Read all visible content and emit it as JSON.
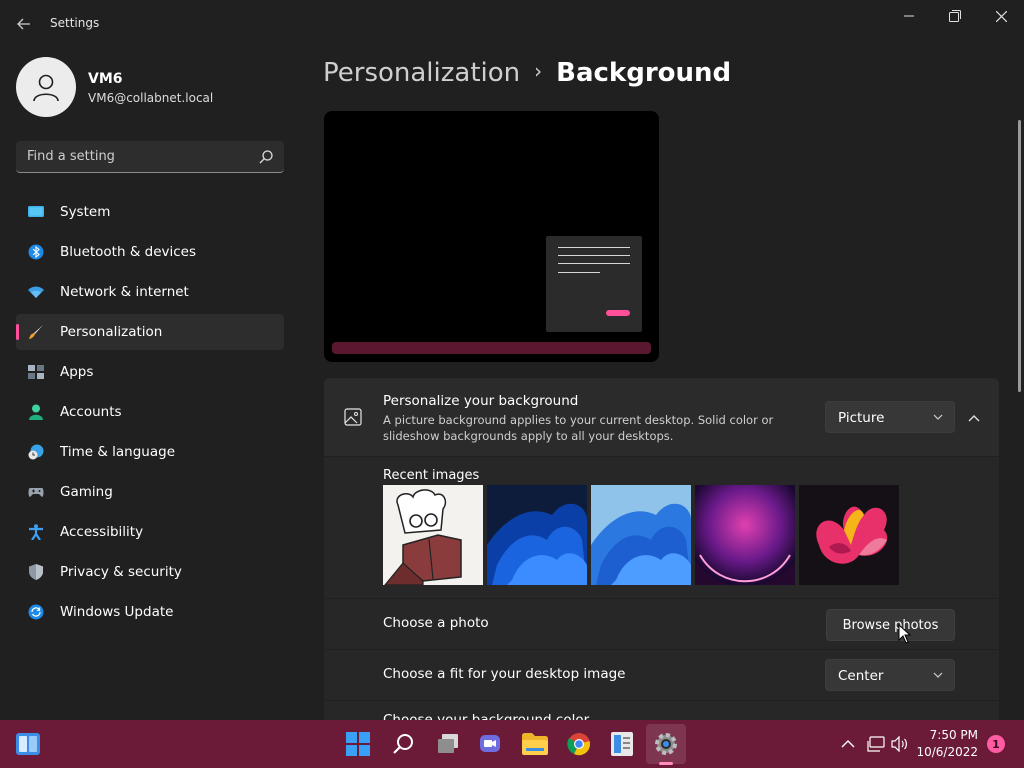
{
  "window": {
    "title": "Settings"
  },
  "user": {
    "name": "VM6",
    "email": "VM6@collabnet.local"
  },
  "search": {
    "placeholder": "Find a setting"
  },
  "sidebar": {
    "items": [
      {
        "label": "System",
        "icon": "monitor-icon"
      },
      {
        "label": "Bluetooth & devices",
        "icon": "bluetooth-icon"
      },
      {
        "label": "Network & internet",
        "icon": "wifi-icon"
      },
      {
        "label": "Personalization",
        "icon": "brush-icon",
        "selected": true
      },
      {
        "label": "Apps",
        "icon": "apps-icon"
      },
      {
        "label": "Accounts",
        "icon": "person-icon"
      },
      {
        "label": "Time & language",
        "icon": "clock-globe-icon"
      },
      {
        "label": "Gaming",
        "icon": "gamepad-icon"
      },
      {
        "label": "Accessibility",
        "icon": "accessibility-icon"
      },
      {
        "label": "Privacy & security",
        "icon": "shield-icon"
      },
      {
        "label": "Windows Update",
        "icon": "update-icon"
      }
    ]
  },
  "breadcrumb": {
    "parent": "Personalization",
    "separator": "›",
    "current": "Background"
  },
  "background_setting": {
    "title": "Personalize your background",
    "description": "A picture background applies to your current desktop. Solid color or slideshow backgrounds apply to all your desktops.",
    "selected": "Picture"
  },
  "recent_images": {
    "label": "Recent images",
    "images": [
      "sketch-character-image",
      "blue-bloom-dark-image",
      "blue-bloom-light-image",
      "purple-glow-image",
      "flower-petals-image"
    ]
  },
  "choose_photo": {
    "label": "Choose a photo",
    "button": "Browse photos"
  },
  "fit": {
    "label": "Choose a fit for your desktop image",
    "selected": "Center"
  },
  "color_row": {
    "label": "Choose your background color"
  },
  "taskbar": {
    "time": "7:50 PM",
    "date": "10/6/2022",
    "notifications": "1"
  },
  "colors": {
    "accent": "#ff4f9a",
    "taskbar": "#6b1a38",
    "background": "#202020",
    "card": "#2b2b2b"
  }
}
